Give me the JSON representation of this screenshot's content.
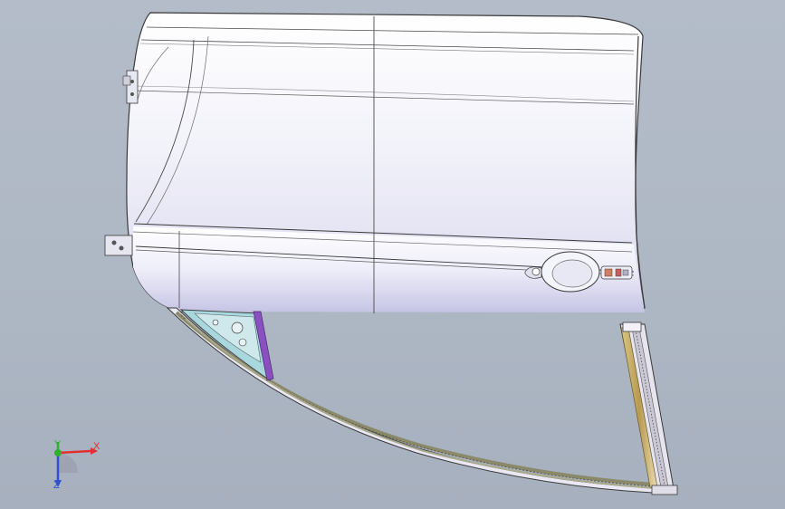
{
  "viewport": {
    "background_color": "#b0b9c6",
    "model": "car-door-assembly"
  },
  "triad": {
    "x_label": "X",
    "y_label": "Y",
    "z_label": "Z",
    "x_color": "#e03030",
    "y_color": "#30b030",
    "z_color": "#3050d0"
  },
  "colors": {
    "panel_light": "#f4f4fb",
    "panel_shade": "#c9c7e6",
    "edge": "#3a3a3a",
    "seal": "#8a8a6a",
    "bracket": "#9ad0d8",
    "purple_bar": "#7a3fb0",
    "rail_tan": "#c8b070"
  }
}
